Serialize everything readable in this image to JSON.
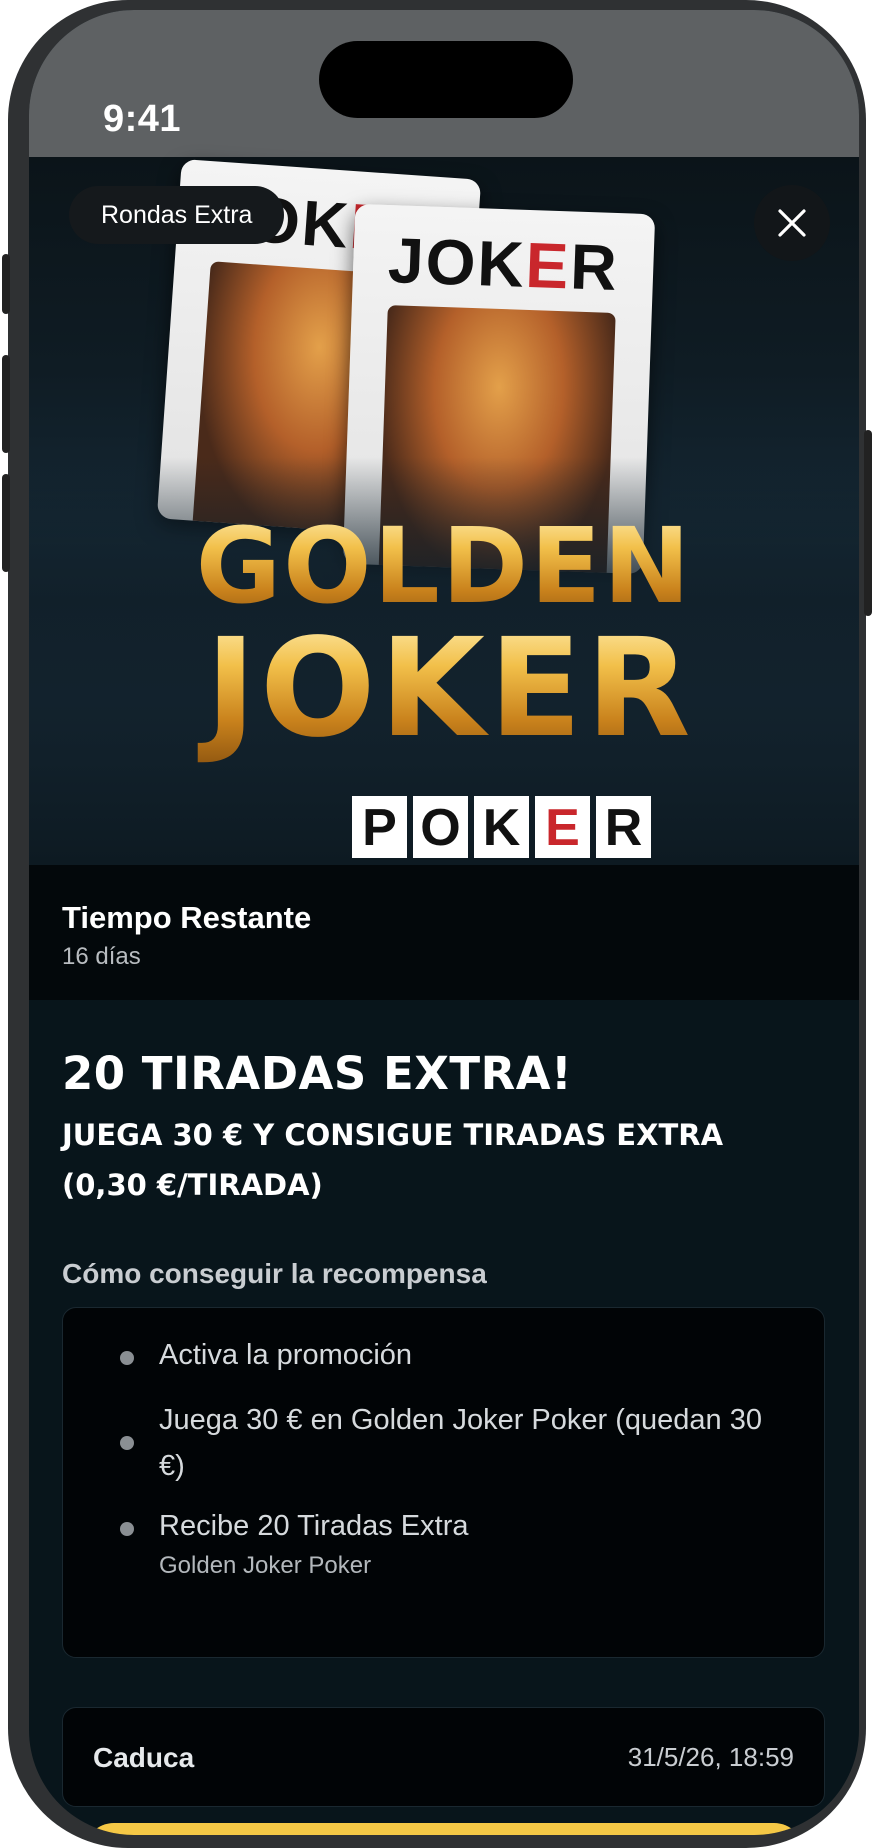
{
  "status_bar": {
    "time": "9:41"
  },
  "hero": {
    "badge": "Rondas Extra",
    "card_word_start": "JOK",
    "card_word_e": "E",
    "card_word_end": "R",
    "title_line1": "GOLDEN",
    "title_line2": "JOKER",
    "poker_letters": [
      "P",
      "O",
      "K",
      "E",
      "R"
    ]
  },
  "timer": {
    "label": "Tiempo Restante",
    "value": "16 días"
  },
  "promo": {
    "title": "20 TIRADAS EXTRA!",
    "subtitle": "JUEGA 30 € Y CONSIGUE TIRADAS EXTRA (0,30 €/TIRADA)"
  },
  "how_to": {
    "label": "Cómo conseguir la recompensa",
    "steps": [
      {
        "text": "Activa la promoción"
      },
      {
        "text": "Juega 30 € en Golden Joker Poker (quedan 30 €)"
      },
      {
        "text": "Recibe 20 Tiradas Extra",
        "sub": "Golden Joker Poker"
      }
    ]
  },
  "expiry": {
    "label": "Caduca",
    "value": "31/5/26, 18:59"
  },
  "colors": {
    "accent": "#f5c846",
    "background": "#08151b",
    "close_icon": "#ffffff"
  },
  "icons": {
    "close": "close-icon"
  }
}
